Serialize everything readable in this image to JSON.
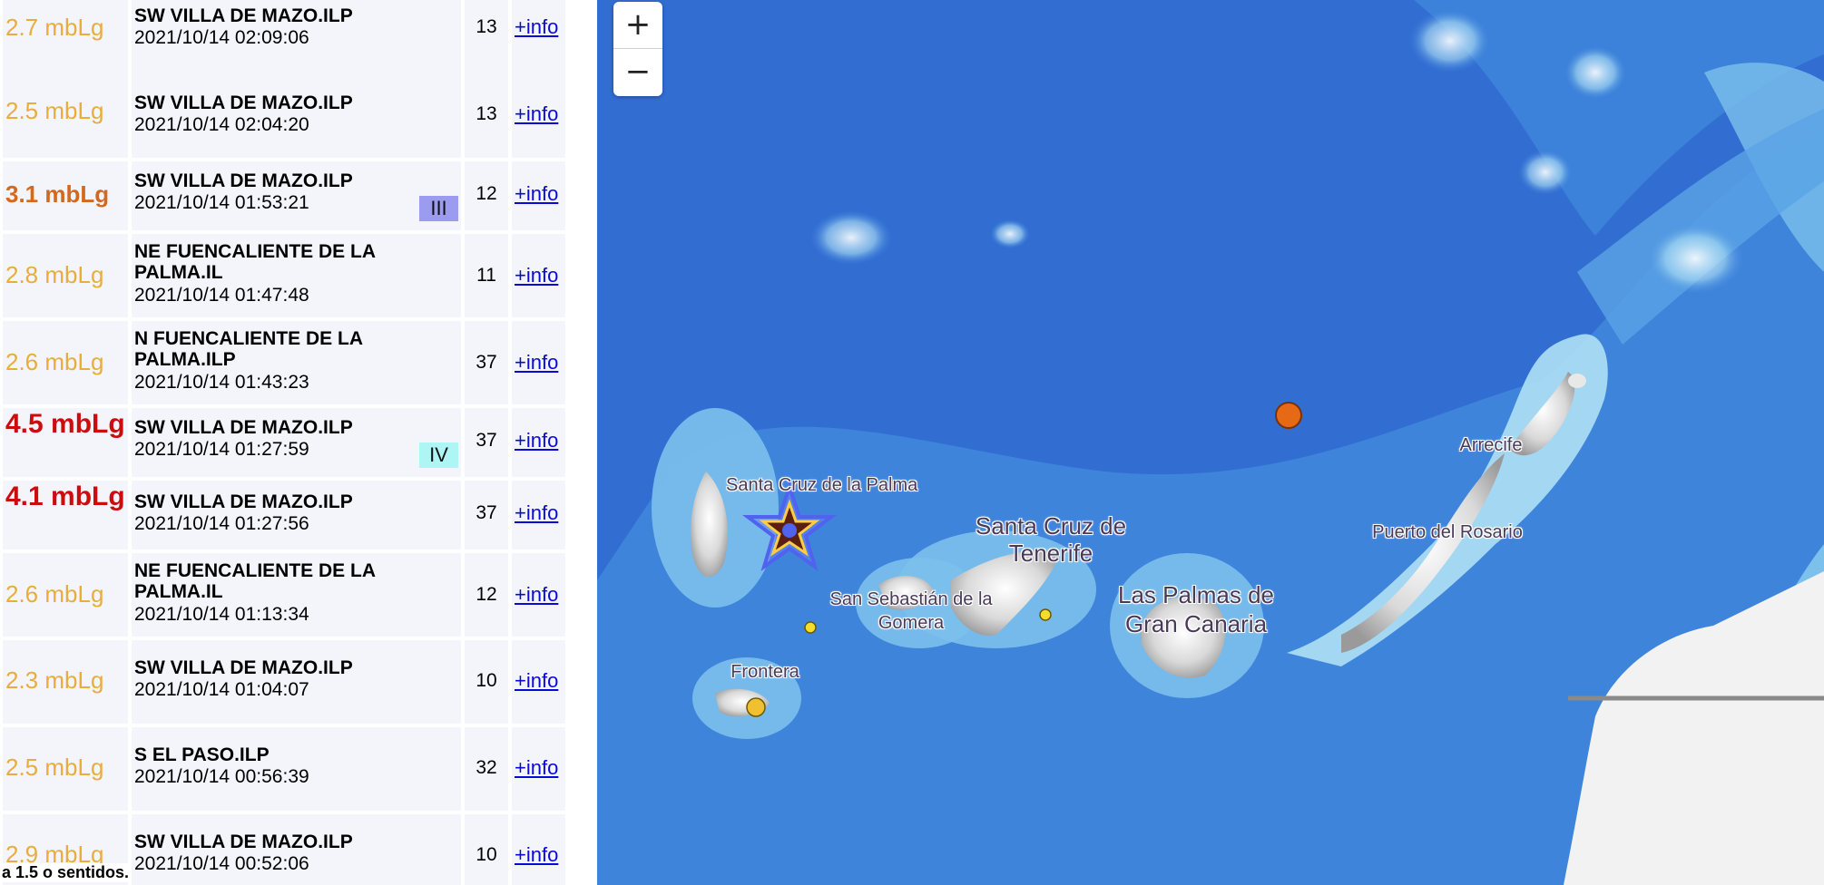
{
  "list": {
    "rows": [
      {
        "magnitude": "2.7 mbLg",
        "mag_level": "yellow",
        "place": "SW VILLA DE MAZO.ILP",
        "date": "2021/10/14 02:09:06",
        "count": "13",
        "link": "+info",
        "intensity": ""
      },
      {
        "magnitude": "2.5 mbLg",
        "mag_level": "yellow",
        "place": "SW VILLA DE MAZO.ILP",
        "date": "2021/10/14 02:04:20",
        "count": "13",
        "link": "+info",
        "intensity": ""
      },
      {
        "magnitude": "3.1 mbLg",
        "mag_level": "orange",
        "place": "SW VILLA DE MAZO.ILP",
        "date": "2021/10/14 01:53:21",
        "count": "12",
        "link": "+info",
        "intensity": "III",
        "intensity_color": "#9b9bf0"
      },
      {
        "magnitude": "2.8 mbLg",
        "mag_level": "yellow",
        "place": "NE FUENCALIENTE DE LA PALMA.IL",
        "date": "2021/10/14 01:47:48",
        "count": "11",
        "link": "+info",
        "intensity": ""
      },
      {
        "magnitude": "2.6 mbLg",
        "mag_level": "yellow",
        "place": "N FUENCALIENTE DE LA PALMA.ILP",
        "date": "2021/10/14 01:43:23",
        "count": "37",
        "link": "+info",
        "intensity": ""
      },
      {
        "magnitude": "4.5 mbLg",
        "mag_level": "red",
        "place": "SW VILLA DE MAZO.ILP",
        "date": "2021/10/14 01:27:59",
        "count": "37",
        "link": "+info",
        "intensity": "IV",
        "intensity_color": "#aef6f6"
      },
      {
        "magnitude": "4.1 mbLg",
        "mag_level": "red",
        "place": "SW VILLA DE MAZO.ILP",
        "date": "2021/10/14 01:27:56",
        "count": "37",
        "link": "+info",
        "intensity": ""
      },
      {
        "magnitude": "2.6 mbLg",
        "mag_level": "yellow",
        "place": "NE FUENCALIENTE DE LA PALMA.IL",
        "date": "2021/10/14 01:13:34",
        "count": "12",
        "link": "+info",
        "intensity": ""
      },
      {
        "magnitude": "2.3 mbLg",
        "mag_level": "yellow",
        "place": "SW VILLA DE MAZO.ILP",
        "date": "2021/10/14 01:04:07",
        "count": "10",
        "link": "+info",
        "intensity": ""
      },
      {
        "magnitude": "2.5 mbLg",
        "mag_level": "yellow",
        "place": "S EL PASO.ILP",
        "date": "2021/10/14 00:56:39",
        "count": "32",
        "link": "+info",
        "intensity": ""
      },
      {
        "magnitude": "2.9 mbLg",
        "mag_level": "yellow",
        "place": "SW VILLA DE MAZO.ILP",
        "date": "2021/10/14 00:52:06",
        "count": "10",
        "link": "+info",
        "intensity": ""
      }
    ],
    "footnote": "a 1.5 o sentidos."
  },
  "map": {
    "zoom_in_label": "+",
    "zoom_out_label": "−",
    "labels": {
      "santa_cruz_palma": "Santa Cruz de la Palma",
      "santa_cruz_tenerife": "Santa Cruz de Tenerife",
      "san_sebastian": "San Sebastián de la Gomera",
      "frontera": "Frontera",
      "las_palmas": "Las Palmas de Gran Canaria",
      "puerto_rosario": "Puerto del Rosario",
      "arrecife": "Arrecife"
    },
    "colors": {
      "deep_sea": "#2f6bd0",
      "mid_sea": "#3f86dc",
      "shelf": "#7cc0ec",
      "coast": "#aee0f4",
      "land": "#f2f2f2",
      "quake_orange": "#e66a16",
      "quake_yellow": "#f5dd2b",
      "star_outline": "#5a6df0"
    }
  }
}
